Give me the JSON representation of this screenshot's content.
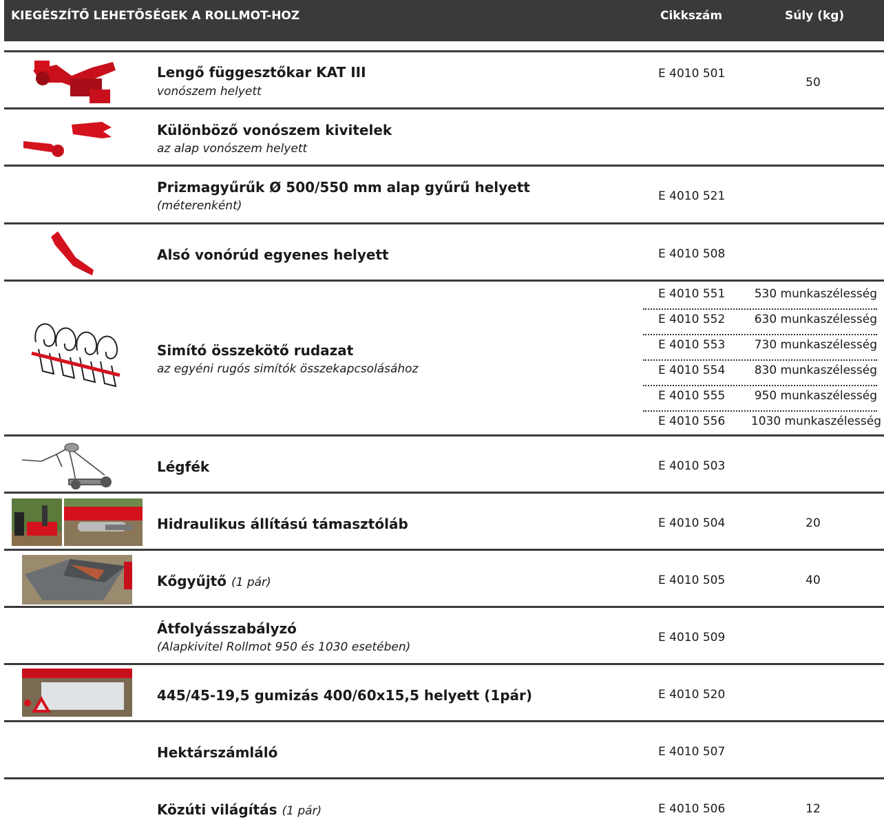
{
  "header": {
    "title": "KIEGÉSZÍTŐ LEHETŐSÉGEK A ROLLMOT-HOZ",
    "code_col": "Cikkszám",
    "weight_col": "Súly (kg)"
  },
  "rows": [
    {
      "title": "Lengő függesztőkar KAT III",
      "subtitle": "vonószem helyett",
      "code": "E 4010 501",
      "weight": "50"
    },
    {
      "title": "Különböző vonószem kivitelek",
      "subtitle": "az alap vonószem helyett",
      "code": "",
      "weight": ""
    },
    {
      "title": "Prizmagyűrűk Ø 500/550 mm alap gyűrű helyett",
      "subtitle": "(méterenként)",
      "code": "E 4010 521",
      "weight": ""
    },
    {
      "title": "Alsó vonórúd egyenes helyett",
      "subtitle": "",
      "code": "E 4010 508",
      "weight": ""
    },
    {
      "title": "Simító összekötő rudazat",
      "subtitle": "az egyéni rugós simítók összekapcsolásához",
      "code": "",
      "weight": "",
      "variants": [
        {
          "code": "E 4010 551",
          "width": "530 munkaszélesség"
        },
        {
          "code": "E 4010 552",
          "width": "630 munkaszélesség"
        },
        {
          "code": "E 4010 553",
          "width": "730 munkaszélesség"
        },
        {
          "code": "E 4010 554",
          "width": "830 munkaszélesség"
        },
        {
          "code": "E 4010 555",
          "width": "950 munkaszélesség"
        },
        {
          "code": "E 4010 556",
          "width": "1030 munkaszélesség"
        }
      ]
    },
    {
      "title": "Légfék",
      "subtitle": "",
      "code": "E 4010 503",
      "weight": ""
    },
    {
      "title": "Hidraulikus állítású támasztóláb",
      "subtitle": "",
      "code": "E 4010 504",
      "weight": "20"
    },
    {
      "title": "Kőgyűjtő",
      "inline_note": "(1 pár)",
      "code": "E 4010 505",
      "weight": "40"
    },
    {
      "title": "Átfolyásszabályzó",
      "subtitle": "(Alapkivitel Rollmot 950 és 1030 esetében)",
      "code": "E 4010 509",
      "weight": ""
    },
    {
      "title": "445/45-19,5 gumizás 400/60x15,5 helyett (1pár)",
      "subtitle": "",
      "code": "E 4010 520",
      "weight": ""
    },
    {
      "title": "Hektárszámláló",
      "subtitle": "",
      "code": "E 4010 507",
      "weight": ""
    },
    {
      "title": "Közúti világítás",
      "inline_note": "(1 pár)",
      "code": "E 4010 506",
      "weight": "12"
    }
  ],
  "colors": {
    "accent_red": "#d4121e",
    "header_bg": "#3a3a3a",
    "rule": "#3a3a3a"
  }
}
